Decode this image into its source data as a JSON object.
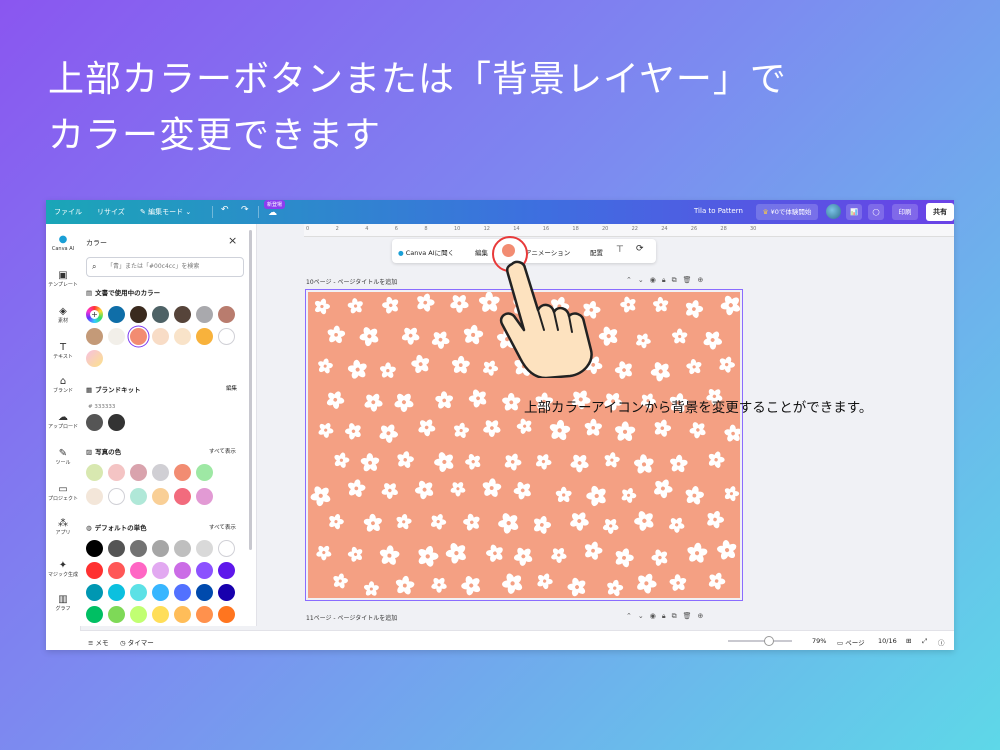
{
  "slide": {
    "title_line1": "上部カラーボタンまたは「背景レイヤー」で",
    "title_line2": "カラー変更できます",
    "annotation": "上部カラーアイコンから背景を変更することができます。"
  },
  "topbar": {
    "file": "ファイル",
    "resize": "リサイズ",
    "edit_mode": "編集モード",
    "new_badge": "新登場",
    "doc_title": "Tila to Pattern",
    "trial": "¥0で体験開始",
    "print": "印刷",
    "share": "共有"
  },
  "rail": {
    "items": [
      "Canva AI",
      "テンプレート",
      "素材",
      "テキスト",
      "ブランド",
      "アップロード",
      "ツール",
      "プロジェクト",
      "アプリ",
      "マジック生成",
      "グラフ"
    ]
  },
  "panel": {
    "title": "カラー",
    "search_placeholder": "「青」または「#00c4cc」を検索",
    "doc_colors_label": "文書で使用中のカラー",
    "brand_kit_label": "ブランドキット",
    "brand_kit_action": "編集",
    "brand_hex": "# 333333",
    "photo_colors_label": "写真の色",
    "default_colors_label": "デフォルトの単色",
    "show_all": "すべて表示",
    "doc_colors": [
      "#0f6ea8",
      "#3a2a1e",
      "#4e6266",
      "#56443a",
      "#a9a9ad",
      "#b97c6e",
      "#c49a78",
      "#f2efe9",
      "#f28c72",
      "#f8dcc6",
      "#f9e3c9",
      "#f8b23c",
      "#ffffff"
    ],
    "brand_colors": [
      "#555555",
      "#333333"
    ],
    "photo_colors_row1": [
      "#d8e8b0",
      "#f4c4c4",
      "#d9a3ad",
      "#d0cfd4",
      "#f28c72",
      "#9ee8a4"
    ],
    "photo_colors_row2": [
      "#f3e6d9",
      "#ffffff",
      "#b0e8d8",
      "#f9cf96",
      "#f26b7d",
      "#e29ad4"
    ],
    "default_colors": [
      "#000000",
      "#545454",
      "#737373",
      "#a6a6a6",
      "#bfbfbf",
      "#d9d9d9",
      "#ffffff",
      "#ff3131",
      "#ff5757",
      "#ff66c4",
      "#e2a9f1",
      "#cb6ce6",
      "#8c52ff",
      "#5e17eb",
      "#0097b2",
      "#0cc0df",
      "#5ce1e6",
      "#38b6ff",
      "#5271ff",
      "#004aad",
      "#1800ad",
      "#00bf63",
      "#7ed957",
      "#c1ff72",
      "#ffde59",
      "#ffbd59",
      "#ff914d",
      "#ff751f"
    ]
  },
  "ruler": [
    "0",
    "2",
    "4",
    "6",
    "8",
    "10",
    "12",
    "14",
    "16",
    "18",
    "20",
    "22",
    "24",
    "26",
    "28",
    "30"
  ],
  "context_toolbar": {
    "canva_ai": "Canva AIに聞く",
    "edit": "編集",
    "animation": "アニメーション",
    "position": "配置",
    "swatch_color": "#f28c72"
  },
  "pages": {
    "page10_label": "10ページ - ページタイトルを追加",
    "page11_label": "11ページ - ページタイトルを追加"
  },
  "design": {
    "background": "#f4a083",
    "flower_color": "#ffffff"
  },
  "bottombar": {
    "notes": "メモ",
    "timer": "タイマー",
    "zoom": "79%",
    "pages": "ページ",
    "page_count": "10/16",
    "zoom_fraction": 0.79
  }
}
